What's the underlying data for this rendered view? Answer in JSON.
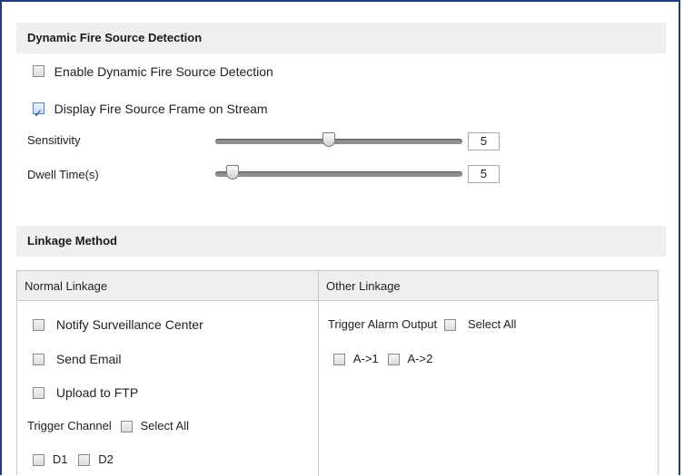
{
  "detection": {
    "header": "Dynamic Fire Source Detection",
    "enable": {
      "label": "Enable Dynamic Fire Source Detection",
      "checked": false
    },
    "display_frame": {
      "label": "Display Fire Source Frame on Stream",
      "checked": true
    },
    "sensitivity": {
      "label": "Sensitivity",
      "value": "5",
      "level_fraction": 0.45
    },
    "dwell_time": {
      "label": "Dwell Time(s)",
      "value": "5",
      "level_fraction": 0.08
    }
  },
  "linkage": {
    "header": "Linkage Method",
    "normal": {
      "title": "Normal Linkage",
      "items": [
        {
          "label": "Notify Surveillance Center",
          "checked": false
        },
        {
          "label": "Send Email",
          "checked": false
        },
        {
          "label": "Upload to FTP",
          "checked": false
        }
      ],
      "trigger_channel": {
        "label": "Trigger Channel",
        "select_all": "Select All"
      },
      "channels": [
        "D1",
        "D2"
      ]
    },
    "other": {
      "title": "Other Linkage",
      "trigger_alarm": {
        "label": "Trigger Alarm Output",
        "select_all": "Select All"
      },
      "outputs": [
        "A->1",
        "A->2"
      ]
    }
  }
}
